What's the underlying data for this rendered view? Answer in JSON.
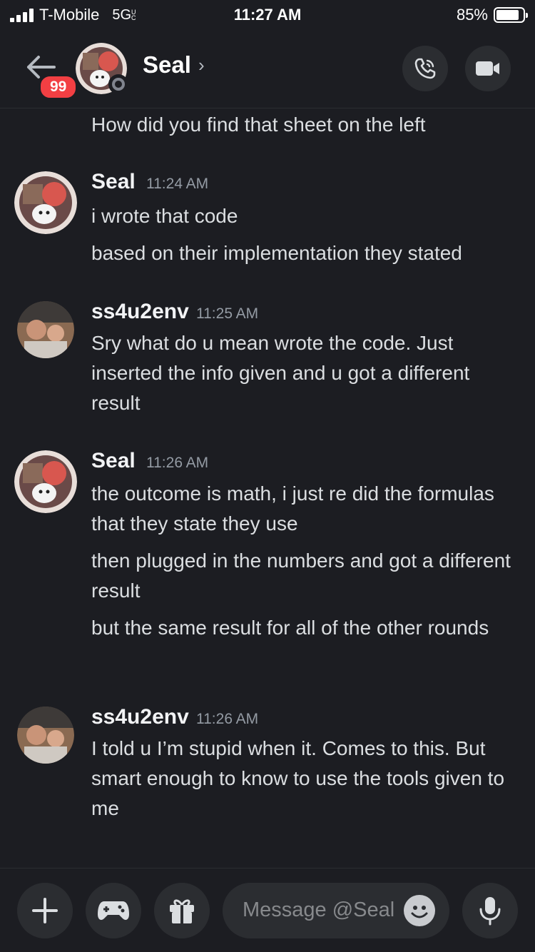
{
  "status_bar": {
    "carrier": "T-Mobile",
    "network": "5G",
    "network_suffix": "UC",
    "time": "11:27 AM",
    "battery": "85%",
    "battery_level": 0.85
  },
  "header": {
    "unread_badge": "99",
    "title": "Seal",
    "chevron": "›"
  },
  "messages": {
    "continuation_line": "How did you find that sheet on the left",
    "groups": [
      {
        "author": "Seal",
        "time": "11:24 AM",
        "lines": [
          "i wrote that code",
          "based on their implementation they stated"
        ]
      },
      {
        "author": "ss4u2env",
        "time": "11:25 AM",
        "lines": [
          "Sry what do u mean wrote the code. Just inserted the info given and u got a different result"
        ]
      },
      {
        "author": "Seal",
        "time": "11:26 AM",
        "lines": [
          "the outcome is math, i just re did the formulas that they state they use",
          "then plugged in the numbers and got a different result",
          "but the same result for all of the other rounds"
        ]
      },
      {
        "author": "ss4u2env",
        "time": "11:26 AM",
        "lines": [
          "I told u I’m stupid when it. Comes to this. But smart enough to know to use the tools given to me"
        ]
      }
    ]
  },
  "composer": {
    "placeholder": "Message @Seal"
  },
  "icons": {
    "back": "arrow-left-icon",
    "call": "phone-icon",
    "video": "video-camera-icon",
    "add": "plus-icon",
    "games": "gamepad-icon",
    "gift": "gift-icon",
    "emoji": "smiley-icon",
    "voice": "microphone-icon"
  },
  "colors": {
    "background": "#1c1d22",
    "surface": "#2b2d31",
    "badge": "#f23f43",
    "text": "#dbdee1",
    "muted": "#949ba4"
  }
}
